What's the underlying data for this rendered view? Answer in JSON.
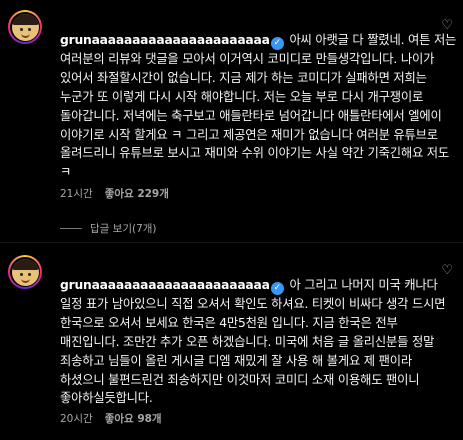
{
  "comments": [
    {
      "username": "grunaaaaaaaaaaaaaaaaaaaaaa",
      "text": " 아씨 아랫글 다 짤렸네. 여튼 저는 여러분의 리뷰와 댓글을 모아서 이거역시 코미디로 만들생각입니다. 나이가 있어서 좌절할시간이 없습니다. 지금 제가 하는 코미디가 실패하면 저희는 누군가 또 이렇게 다시 시작 해야합니다. 저는 오늘 부로 다시 개구쟁이로 돌아갑니다. 저녁에는 축구보고 애들란타로 넘어갑니다 애틀란타에서 엘에이 이야기로 시작 할게요 ㅋ 그리고 제공연은 재미가 없습니다 여러분 유튜브로 올려드리니 유튜브로 보시고 재미와 수위 이야기는 사실 약간 기죽긴해요 저도 ㅋ",
      "time": "21시간",
      "likes": "좋아요 229개"
    },
    {
      "username": "grunaaaaaaaaaaaaaaaaaaaaaa",
      "text": " 아 그리고 나머지 미국 캐나다 일정 표가 남아있으니 직접 오셔서 확인도 하셔요. 티켓이 비싸다 생각 드시면 한국으로 오셔서 보세요 한국은 4만5천원 입니다. 지금 한국은 전부 매진입니다. 조만간 추가 오픈 하겠습니다. 미국에 처음 글 올리신분들 정말 죄송하고 님들이 올린 게시글 디엠 재밌게 잘 사용 해 볼게요 제 팬이라 하셨으니 불편드린건 죄송하지만 이것마저 코미디 소재 이용해도 팬이니 좋아하실듯합니다.",
      "time": "20시간",
      "likes": "좋아요 98개"
    }
  ],
  "replies_toggle": "답글 보기(7개)",
  "colors": {
    "verified": "#3897f0",
    "meta": "#a8a8a8",
    "bg": "#000000"
  },
  "icons": {
    "verified": "verified-badge-icon",
    "like": "heart-icon"
  }
}
